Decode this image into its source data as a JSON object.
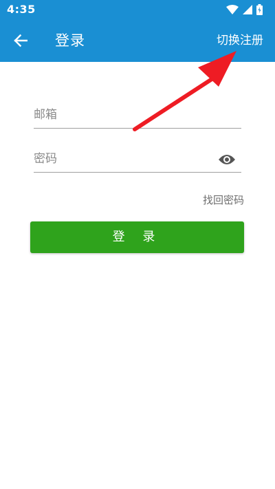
{
  "status_bar": {
    "time": "4:35",
    "icons": [
      "wifi-icon",
      "signal-icon",
      "battery-icon"
    ]
  },
  "app_bar": {
    "title": "登录",
    "action_label": "切换注册",
    "back_icon": "arrow-left-icon"
  },
  "form": {
    "email": {
      "placeholder": "邮箱",
      "value": ""
    },
    "password": {
      "placeholder": "密码",
      "value": "",
      "toggle_icon": "eye-icon"
    },
    "forgot_label": "找回密码",
    "submit_label": "登 录"
  },
  "colors": {
    "primary": "#1a8fd3",
    "button": "#2fa31c",
    "annotation": "#ee1c24"
  }
}
